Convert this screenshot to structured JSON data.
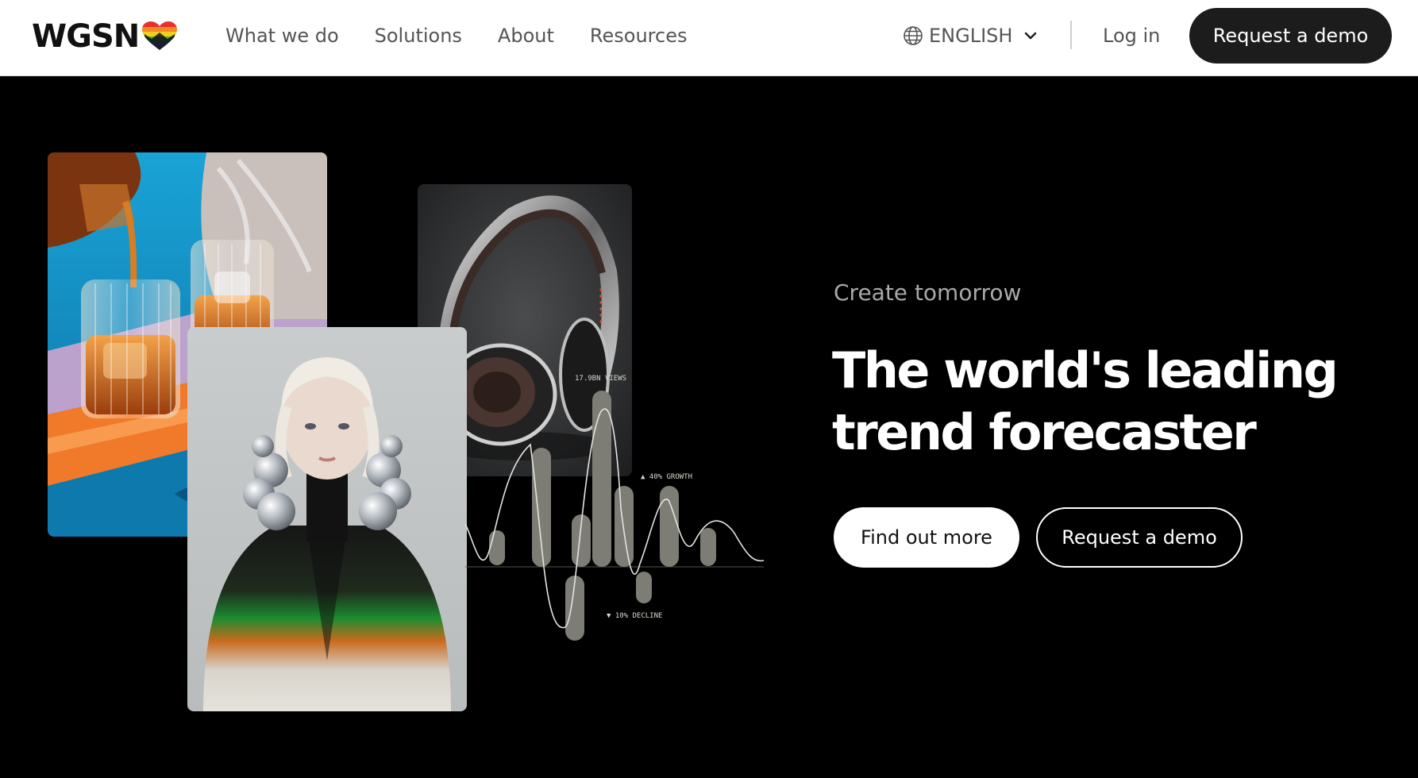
{
  "nav": {
    "logo_text": "WGSN",
    "links": [
      "What we do",
      "Solutions",
      "About",
      "Resources"
    ],
    "language": "ENGLISH",
    "login": "Log in",
    "demo": "Request a demo"
  },
  "hero": {
    "eyebrow": "Create tomorrow",
    "headline_line1": "The world's leading",
    "headline_line2": "trend forecaster",
    "primary_cta": "Find out more",
    "secondary_cta": "Request a demo"
  },
  "trend_graphic": {
    "views_label": "17.9BN VIEWS",
    "growth_label": "▲ 40% GROWTH",
    "decline_label": "▼ 10% DECLINE"
  },
  "colors": {
    "background": "#000000",
    "nav_background": "#ffffff",
    "dark_button": "#1c1c1c",
    "muted_text": "#555555",
    "eyebrow_text": "#a9a9a9",
    "bar_fill": "#7d7d75"
  },
  "icons": [
    "rainbow-heart-icon",
    "globe-icon",
    "chevron-down-icon"
  ]
}
